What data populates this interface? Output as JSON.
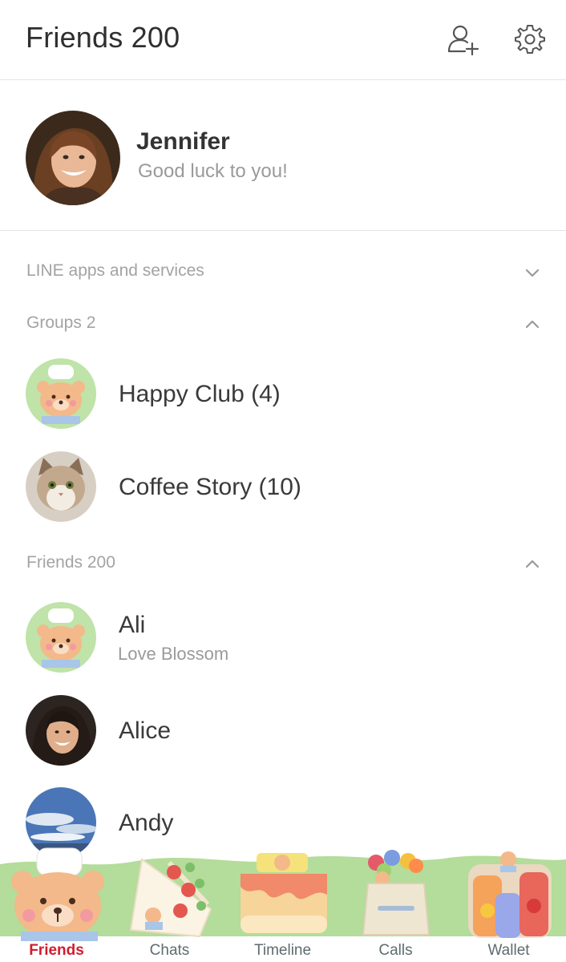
{
  "header": {
    "title": "Friends 200",
    "add_friend_icon": "add-friend-icon",
    "settings_icon": "gear-icon"
  },
  "profile": {
    "name": "Jennifer",
    "status": "Good luck to you!"
  },
  "sections": {
    "services": {
      "label": "LINE apps and services",
      "state": "collapsed"
    },
    "groups": {
      "label": "Groups 2",
      "state": "expanded"
    },
    "friends": {
      "label": "Friends 200",
      "state": "expanded"
    }
  },
  "groups": [
    {
      "name": "Happy Club (4)",
      "avatar": "bear-chef"
    },
    {
      "name": "Coffee Story (10)",
      "avatar": "cat"
    }
  ],
  "friends": [
    {
      "name": "Ali",
      "status": "Love Blossom",
      "avatar": "bear-chef"
    },
    {
      "name": "Alice",
      "status": "",
      "avatar": "person"
    },
    {
      "name": "Andy",
      "status": "",
      "avatar": "sky"
    }
  ],
  "tabs": [
    {
      "label": "Friends",
      "active": true
    },
    {
      "label": "Chats",
      "active": false
    },
    {
      "label": "Timeline",
      "active": false
    },
    {
      "label": "Calls",
      "active": false
    },
    {
      "label": "Wallet",
      "active": false
    }
  ],
  "colors": {
    "active_tab": "#d01d2d",
    "tab_label": "#5f6b6f",
    "section_label": "#a3a3a3",
    "divider": "#e4e4e4",
    "theme_green": "#a8d68f"
  }
}
